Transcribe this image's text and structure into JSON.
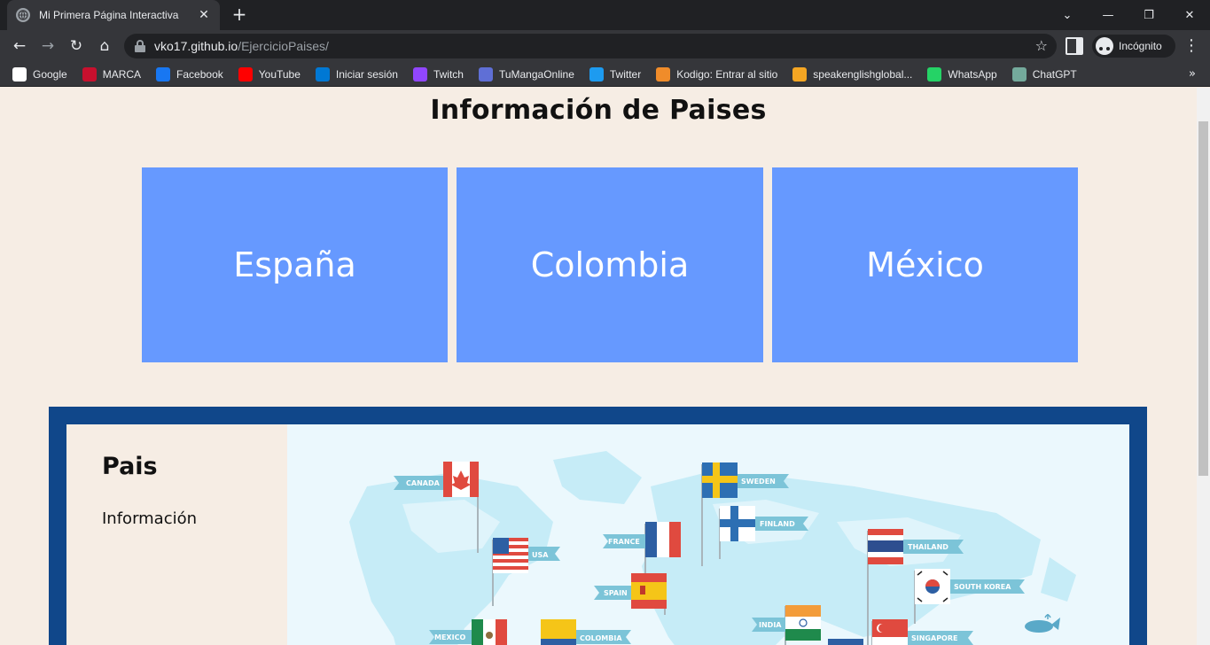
{
  "browser": {
    "tab_title": "Mi Primera Página Interactiva",
    "url_host": "vko17.github.io",
    "url_path": "/EjercicioPaises/",
    "profile_label": "Incógnito",
    "bookmarks": [
      {
        "label": "Google",
        "color": "#ffffff",
        "icon": "google-icon"
      },
      {
        "label": "MARCA",
        "color": "#c8102e",
        "icon": "marca-icon"
      },
      {
        "label": "Facebook",
        "color": "#1877f2",
        "icon": "facebook-icon"
      },
      {
        "label": "YouTube",
        "color": "#ff0000",
        "icon": "youtube-icon"
      },
      {
        "label": "Iniciar sesión",
        "color": "#0078d4",
        "icon": "outlook-icon"
      },
      {
        "label": "Twitch",
        "color": "#9146ff",
        "icon": "twitch-icon"
      },
      {
        "label": "TuMangaOnline",
        "color": "#5f6fd6",
        "icon": "tumanga-icon"
      },
      {
        "label": "Twitter",
        "color": "#1d9bf0",
        "icon": "twitter-icon"
      },
      {
        "label": "Kodigo: Entrar al sitio",
        "color": "#f08c2a",
        "icon": "kodigo-icon"
      },
      {
        "label": "speakenglishglobal...",
        "color": "#f5a623",
        "icon": "speakenglish-icon"
      },
      {
        "label": "WhatsApp",
        "color": "#25d366",
        "icon": "whatsapp-icon"
      },
      {
        "label": "ChatGPT",
        "color": "#74aa9c",
        "icon": "chatgpt-icon"
      }
    ]
  },
  "page": {
    "title": "Información de Paises",
    "countries": [
      {
        "label": "España"
      },
      {
        "label": "Colombia"
      },
      {
        "label": "México"
      }
    ],
    "info": {
      "heading": "Pais",
      "text": "Información"
    },
    "map_labels": {
      "canada": "CANADA",
      "usa": "USA",
      "mexico": "MEXICO",
      "colombia": "COLOMBIA",
      "france": "FRANCE",
      "spain": "SPAIN",
      "sweden": "SWEDEN",
      "finland": "FINLAND",
      "india": "INDIA",
      "thailand": "THAILAND",
      "south_korea": "SOUTH KOREA",
      "singapore": "SINGAPORE"
    }
  },
  "colors": {
    "page_bg": "#f6ede4",
    "card_bg": "#6699ff",
    "frame_bg": "#10478a",
    "map_bg": "#ebf8fd"
  }
}
